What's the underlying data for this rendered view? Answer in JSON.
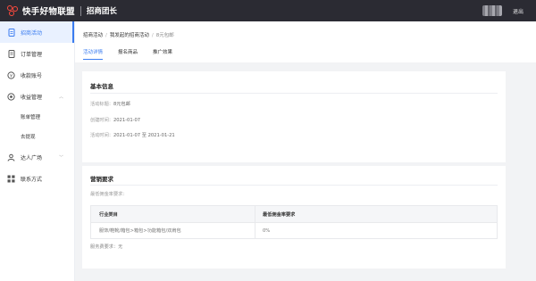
{
  "header": {
    "brand": "快手好物联盟",
    "subtitle": "招商团长",
    "logout": "退出"
  },
  "sidebar": {
    "items": [
      {
        "label": "招商活动",
        "icon": "document-icon",
        "active": true
      },
      {
        "label": "订单管理",
        "icon": "list-icon"
      },
      {
        "label": "收款账号",
        "icon": "wallet-icon"
      },
      {
        "label": "收益管理",
        "icon": "gear-icon",
        "expanded": true
      },
      {
        "label": "账单管理",
        "sub": true
      },
      {
        "label": "去提现",
        "sub": true
      },
      {
        "label": "达人广场",
        "icon": "user-icon",
        "caret": true
      },
      {
        "label": "联系方式",
        "icon": "grid-icon"
      }
    ]
  },
  "breadcrumb": [
    "招商活动",
    "我发起的招商活动",
    "8元包邮"
  ],
  "tabs": [
    "活动详情",
    "报名商品",
    "推广效果"
  ],
  "basic_info": {
    "title": "基本信息",
    "name_label": "活动标题：",
    "name_value": "8元包邮",
    "created_label": "创建时间：",
    "created_value": "2021-01-07",
    "period_label": "活动时间：",
    "period_value": "2021-01-07 至 2021-01-21"
  },
  "marketing": {
    "title": "营销要求",
    "min_rate_label": "最低佣金率要求：",
    "columns": [
      "行业类目",
      "最低佣金率要求"
    ],
    "rows": [
      [
        "服饰/鞋靴/箱包>箱包>功能箱包/双肩包",
        "0%"
      ]
    ],
    "fee_label": "服务费要求：",
    "fee_value": "无"
  },
  "colors": {
    "accent": "#3a7cf0",
    "topbar": "#2b2b33",
    "logo": "#ff4a3d"
  }
}
